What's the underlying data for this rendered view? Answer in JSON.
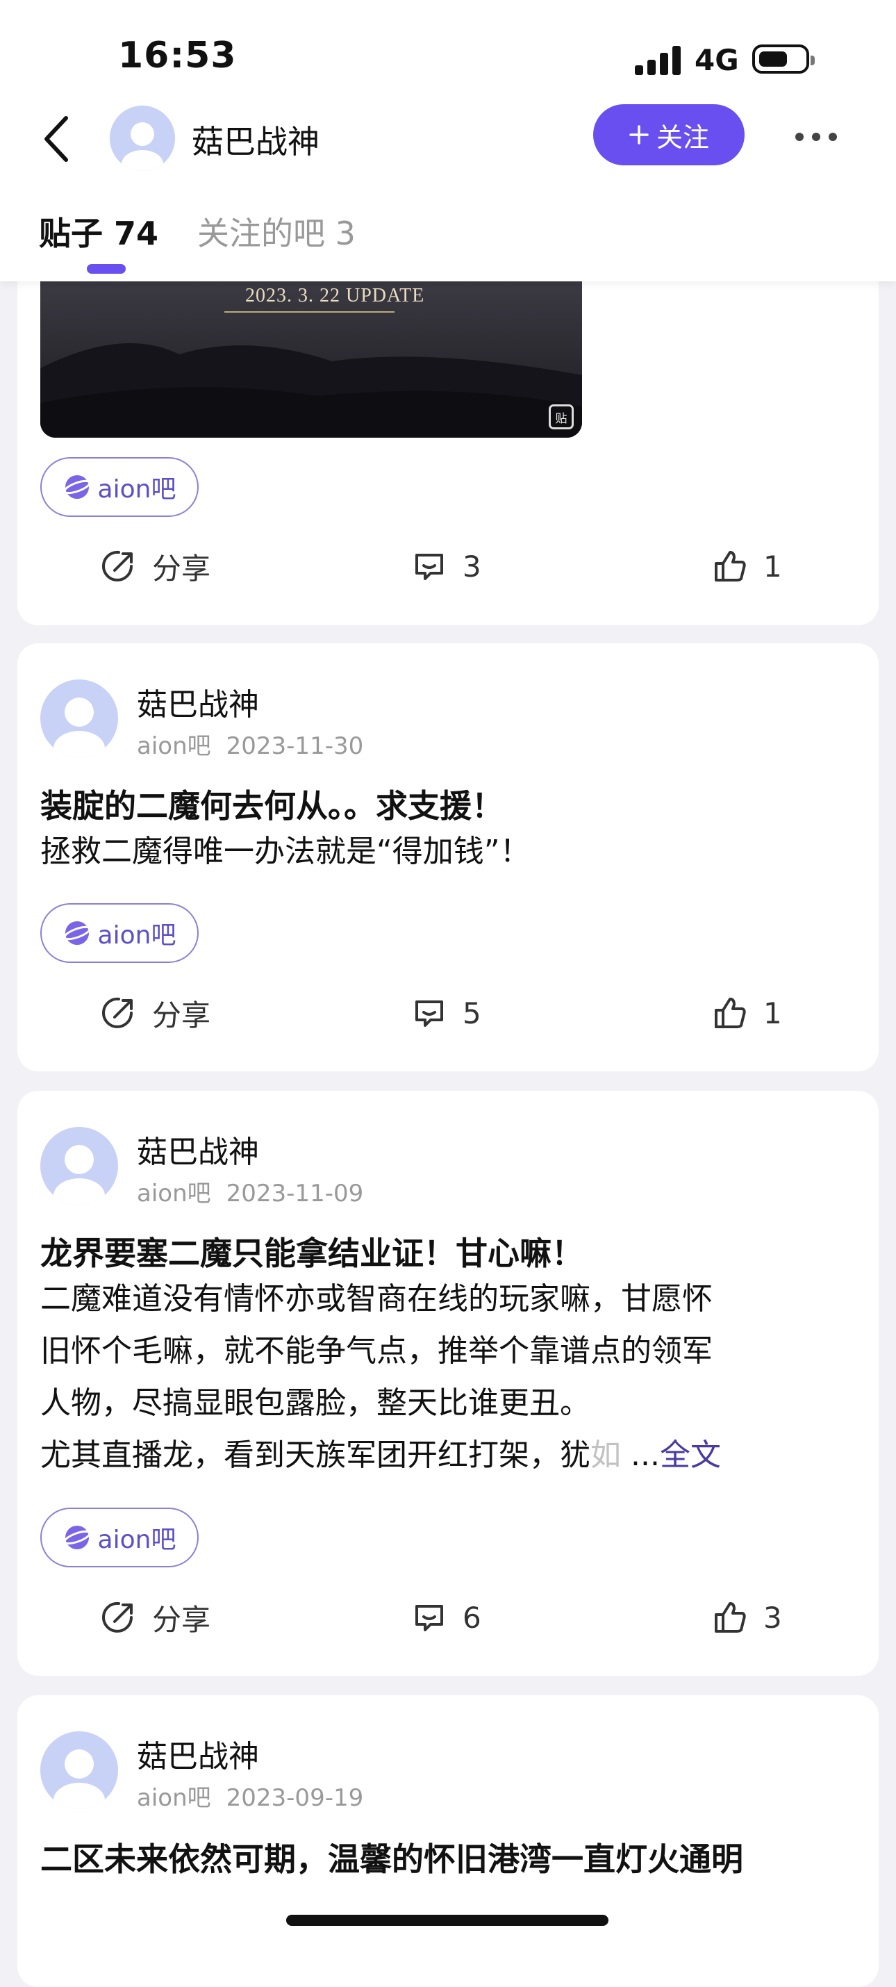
{
  "status_bar": {
    "time": "16:53",
    "network": "4G"
  },
  "header": {
    "username": "菇巴战神",
    "follow_label": "关注",
    "tabs": [
      {
        "label": "贴子 74"
      },
      {
        "label": "关注的吧 3"
      }
    ]
  },
  "posts": [
    {
      "image_caption": "2023. 3. 22  UPDATE",
      "image_badge": "贴",
      "forum_tag": "aion吧",
      "share_label": "分享",
      "comments": "3",
      "likes": "1"
    },
    {
      "username": "菇巴战神",
      "forum": "aion吧",
      "date": "2023-11-30",
      "title": "装腚的二魔何去何从。。求支援！",
      "body": "拯救二魔得唯一办法就是“得加钱”！",
      "forum_tag": "aion吧",
      "share_label": "分享",
      "comments": "5",
      "likes": "1"
    },
    {
      "username": "菇巴战神",
      "forum": "aion吧",
      "date": "2023-11-09",
      "title": "龙界要塞二魔只能拿结业证！甘心嘛！",
      "body_lines": [
        "二魔难道没有情怀亦或智商在线的玩家嘛，甘愿怀",
        "旧怀个毛嘛，就不能争气点，推举个靠谱点的领军",
        "人物，尽搞显眼包露脸，整天比谁更丑。",
        "尤其直播龙，看到天族军团开红打架，犹"
      ],
      "body_fade": "如",
      "ellipsis": " ...",
      "read_more": "全文",
      "forum_tag": "aion吧",
      "share_label": "分享",
      "comments": "6",
      "likes": "3"
    },
    {
      "username": "菇巴战神",
      "forum": "aion吧",
      "date": "2023-09-19",
      "title": "二区未来依然可期，温馨的怀旧港湾一直灯火通明"
    }
  ],
  "colors": {
    "accent": "#6a4ff0",
    "tag_text": "#5b4fc9",
    "background": "#f2f2f6"
  }
}
